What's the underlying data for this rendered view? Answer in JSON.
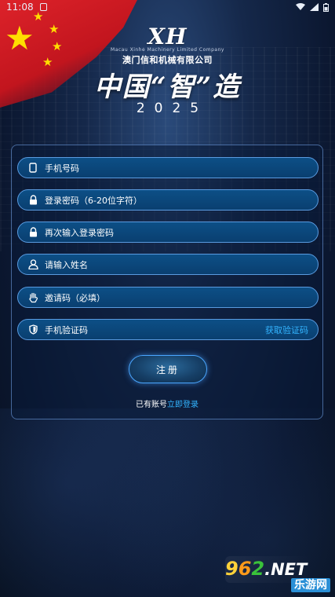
{
  "status_bar": {
    "time": "11:08"
  },
  "brand": {
    "logo": "XH",
    "english_name": "Macau Xinhe Machinery Limited Company",
    "company_name": "澳门信和机械有限公司"
  },
  "slogan": {
    "title": "中国“智”造",
    "year": "2025"
  },
  "form": {
    "fields": [
      {
        "label": "手机号码",
        "icon": "phone-icon"
      },
      {
        "label": "登录密码（6-20位字符）",
        "icon": "lock-icon"
      },
      {
        "label": "再次输入登录密码",
        "icon": "lock-icon"
      },
      {
        "label": "请输入姓名",
        "icon": "user-icon"
      },
      {
        "label": "邀请码（必填）",
        "icon": "hand-icon"
      },
      {
        "label": "手机验证码",
        "icon": "shield-icon",
        "action": "获取验证码"
      }
    ],
    "register_label": "注册",
    "has_account_text": "已有账号",
    "login_link": "立即登录"
  },
  "watermark": {
    "digit_9": "9",
    "digit_6": "6",
    "digit_2": "2",
    "suffix": ".NET",
    "sub": "乐游网"
  },
  "colors": {
    "field_bg": "#0c4f86",
    "field_border": "#5a9be0",
    "link": "#33b4ff",
    "flag_red": "#e0242b",
    "star_yellow": "#ffde00"
  }
}
